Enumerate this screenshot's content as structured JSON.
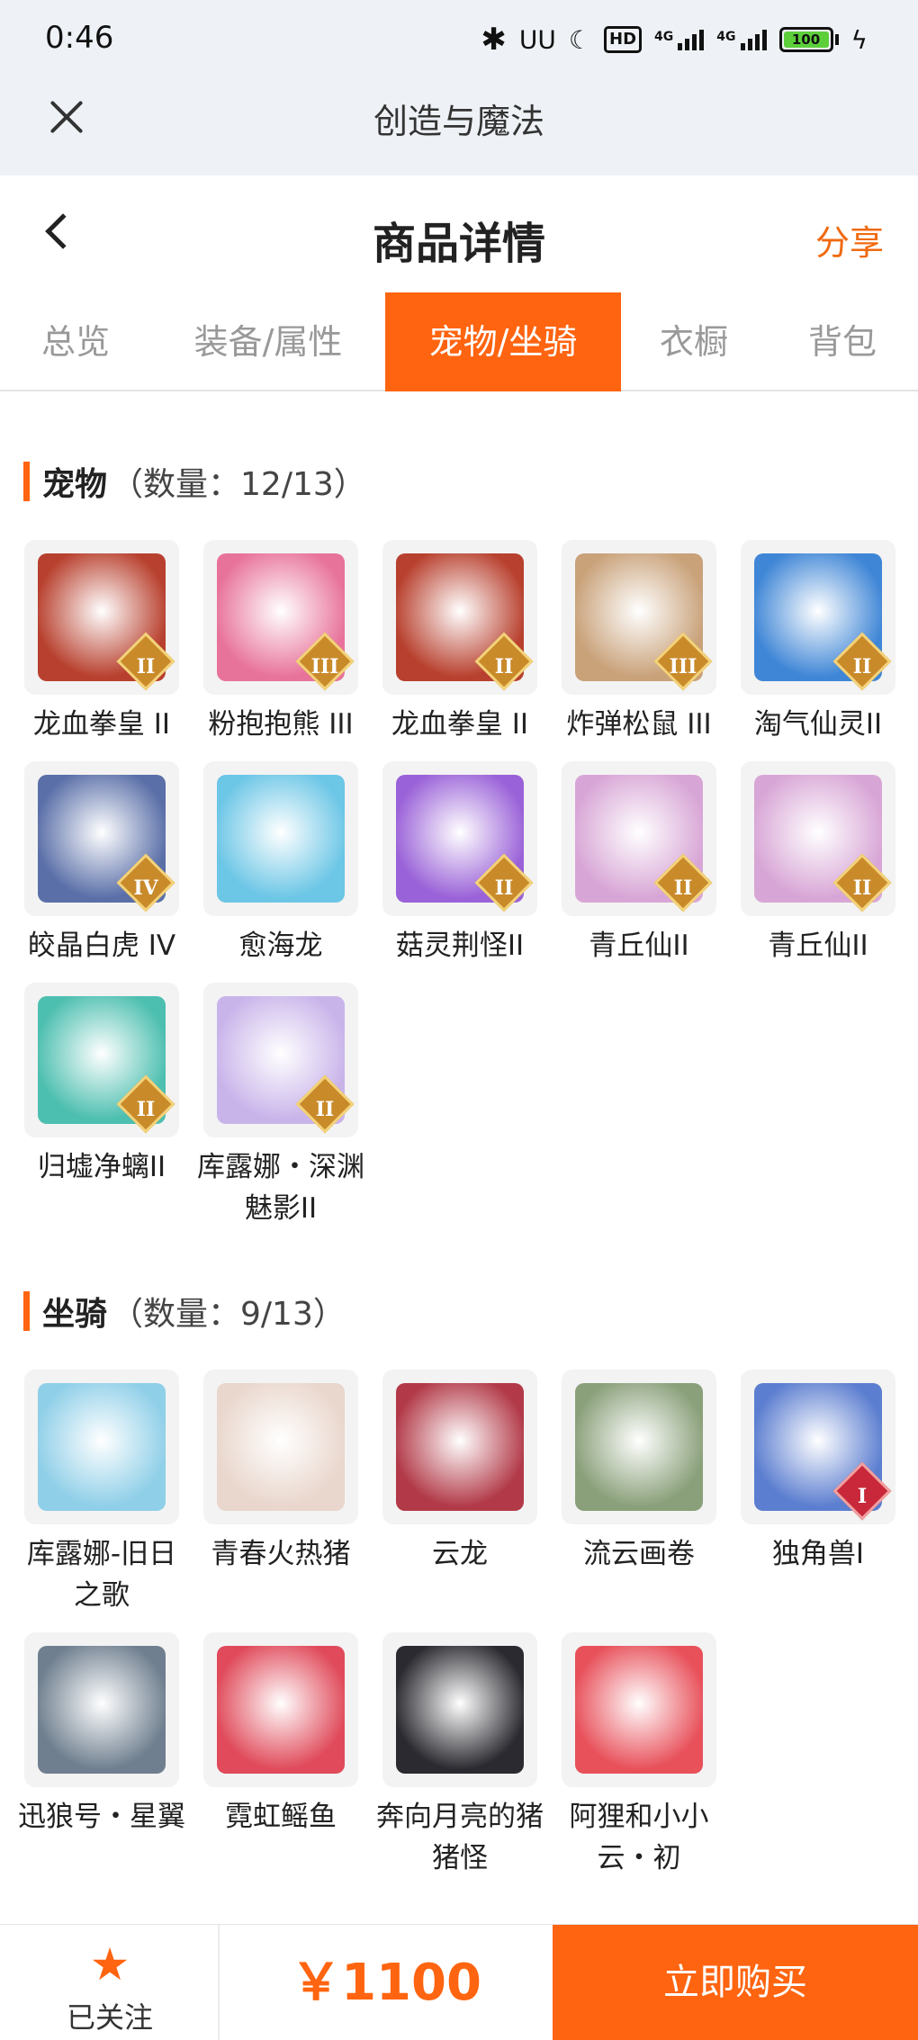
{
  "status": {
    "time": "0:46",
    "battery": "100",
    "net1": "4G",
    "net2": "4G",
    "hd": "HD"
  },
  "webview": {
    "title": "创造与魔法"
  },
  "header": {
    "title": "商品详情",
    "share": "分享"
  },
  "tabs": [
    {
      "label": "总览"
    },
    {
      "label": "装备/属性"
    },
    {
      "label": "宠物/坐骑"
    },
    {
      "label": "衣橱"
    },
    {
      "label": "背包"
    }
  ],
  "active_tab": "宠物/坐骑",
  "pets": {
    "title": "宠物",
    "count": "（数量：12/13）",
    "items": [
      {
        "name": "龙血拳皇 II",
        "badge": "II",
        "icon": "red-dragon-boxer",
        "color": "#b8402e"
      },
      {
        "name": "粉抱抱熊 III",
        "badge": "III",
        "icon": "pink-bear",
        "color": "#e8739a"
      },
      {
        "name": "龙血拳皇 II",
        "badge": "II",
        "icon": "red-dragon-boxer",
        "color": "#b8402e"
      },
      {
        "name": "炸弹松鼠 III",
        "badge": "III",
        "icon": "squirrel",
        "color": "#c9a27a"
      },
      {
        "name": "淘气仙灵II",
        "badge": "II",
        "icon": "blue-fairy-dog",
        "color": "#3f86d6"
      },
      {
        "name": "皎晶白虎 IV",
        "badge": "IV",
        "icon": "white-tiger",
        "color": "#5a6fa8"
      },
      {
        "name": "愈海龙",
        "badge": "",
        "icon": "sea-dragon",
        "color": "#6cc6e6"
      },
      {
        "name": "菇灵荆怪II",
        "badge": "II",
        "icon": "mushroom-sprite",
        "color": "#9a62d8"
      },
      {
        "name": "青丘仙II",
        "badge": "II",
        "icon": "fox-fairy",
        "color": "#d8a6d6"
      },
      {
        "name": "青丘仙II",
        "badge": "II",
        "icon": "fox-fairy",
        "color": "#d8a6d6"
      },
      {
        "name": "归墟净螭II",
        "badge": "II",
        "icon": "jade-dragon",
        "color": "#4dbfb0"
      },
      {
        "name": "库露娜・深渊魅影II",
        "badge": "II",
        "icon": "abyss-maiden",
        "color": "#c9b4ea"
      }
    ]
  },
  "mounts": {
    "title": "坐骑",
    "count": "（数量：9/13）",
    "items": [
      {
        "name": "库露娜-旧日之歌",
        "badge": "",
        "icon": "sheep-maiden",
        "color": "#8fcfe8"
      },
      {
        "name": "青春火热猪",
        "badge": "",
        "icon": "pig",
        "color": "#e9d6cc"
      },
      {
        "name": "云龙",
        "badge": "",
        "icon": "cloud-dragon",
        "color": "#b23a48"
      },
      {
        "name": "流云画卷",
        "badge": "",
        "icon": "bamboo-scroll",
        "color": "#8aa07a"
      },
      {
        "name": "独角兽I",
        "badge": "I",
        "icon": "unicorn",
        "color": "#5c7ed0"
      },
      {
        "name": "迅狼号・星翼",
        "badge": "",
        "icon": "mecha-wolf",
        "color": "#6f7f8f"
      },
      {
        "name": "霓虹鳐鱼",
        "badge": "",
        "icon": "neon-ray",
        "color": "#e04a5a"
      },
      {
        "name": "奔向月亮的猪猪怪",
        "badge": "",
        "icon": "black-pig",
        "color": "#2b2a30"
      },
      {
        "name": "阿狸和小小云・初",
        "badge": "",
        "icon": "fox-cloud",
        "color": "#e8505a"
      }
    ]
  },
  "bottom": {
    "follow_label": "已关注",
    "price": "￥1100",
    "buy_label": "立即购买"
  }
}
